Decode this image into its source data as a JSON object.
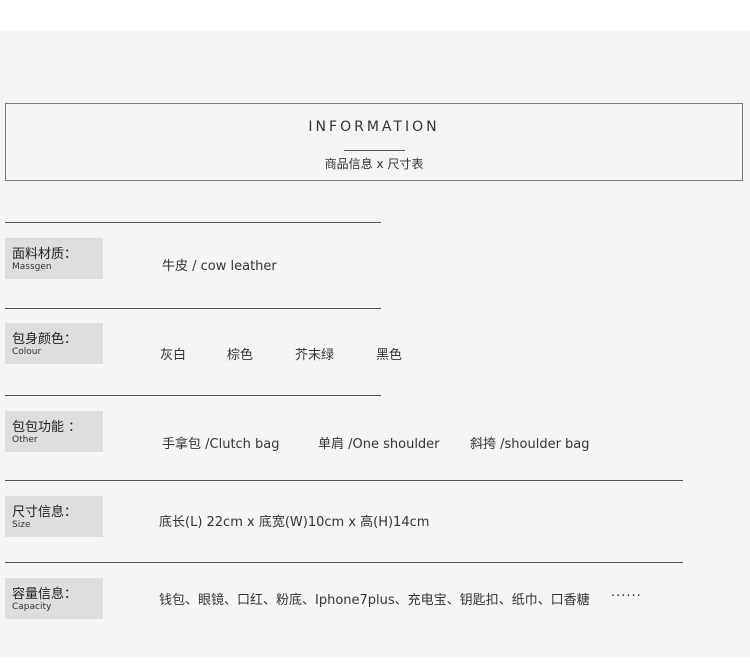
{
  "header": {
    "title": "INFORMATION",
    "subtitle": "商品信息 x 尺寸表"
  },
  "rows": [
    {
      "label_cn": "面料材质：",
      "label_en": "Massgen",
      "values": [
        "牛皮 / cow leather"
      ]
    },
    {
      "label_cn": "包身颜色：",
      "label_en": "Colour",
      "values": [
        "灰白",
        "棕色",
        "芥末绿",
        "黑色"
      ]
    },
    {
      "label_cn": "包包功能 ：",
      "label_en": "Other",
      "values": [
        "手拿包 /Clutch bag",
        "单肩 /One shoulder",
        "斜挎 /shoulder bag"
      ]
    },
    {
      "label_cn": "尺寸信息：",
      "label_en": "Size",
      "values": [
        "底长(L) 22cm  x  底宽(W)10cm  x  高(H)14cm"
      ]
    },
    {
      "label_cn": "容量信息：",
      "label_en": "Capacity",
      "values": [
        "钱包、眼镜、口红、粉底、Iphone7plus、充电宝、钥匙扣、纸巾、口香糖",
        "······"
      ]
    }
  ]
}
